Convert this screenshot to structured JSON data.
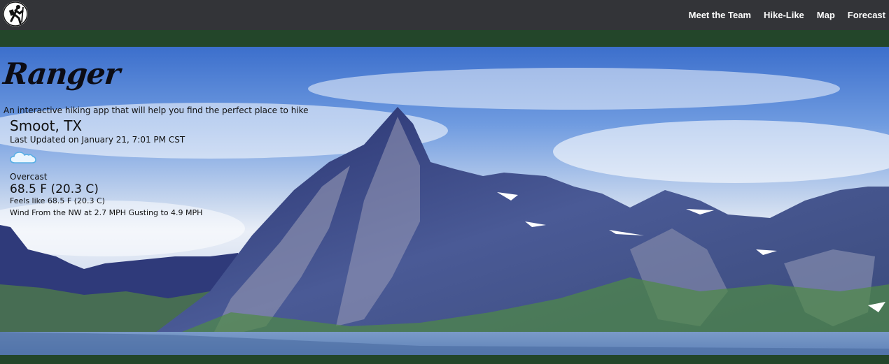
{
  "nav": {
    "logo_icon": "hiker-icon",
    "links": [
      "Meet the Team",
      "Hike-Like",
      "Map",
      "Forecast"
    ]
  },
  "hero": {
    "brand": "Ranger",
    "tagline": "An interactive hiking app that will help you find the perfect place to hike",
    "background": "mountain-lake-landscape"
  },
  "weather": {
    "location": "Smoot, TX",
    "updated": "Last Updated on January 21, 7:01 PM CST",
    "icon": "cloud-icon",
    "condition": "Overcast",
    "temperature": "68.5 F (20.3 C)",
    "feels_like": "Feels like 68.5 F (20.3 C)",
    "wind": "Wind From the NW at 2.7 MPH Gusting to 4.9 MPH"
  },
  "colors": {
    "navbar": "#333438",
    "band": "#23462a",
    "sky_top": "#3c6fcc"
  }
}
